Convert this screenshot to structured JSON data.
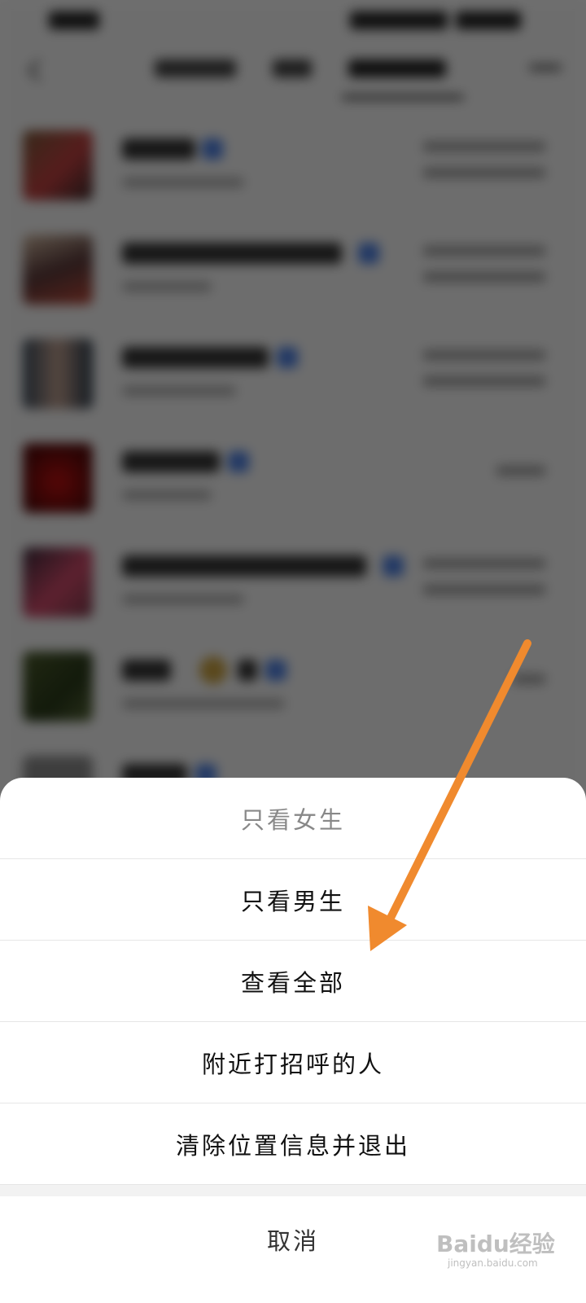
{
  "menu": {
    "items": [
      {
        "label": "只看女生"
      },
      {
        "label": "只看男生"
      },
      {
        "label": "查看全部"
      },
      {
        "label": "附近打招呼的人"
      },
      {
        "label": "清除位置信息并退出"
      }
    ],
    "cancel_label": "取消"
  },
  "watermark": {
    "brand": "Baidu经验",
    "url": "jingyan.baidu.com"
  },
  "colors": {
    "annotation_arrow": "#f08a2e",
    "sheet_background": "#ffffff",
    "overlay": "rgba(0,0,0,0.55)"
  },
  "icons": {
    "back": "back-arrow-icon",
    "annotation": "orange-arrow-annotation"
  }
}
